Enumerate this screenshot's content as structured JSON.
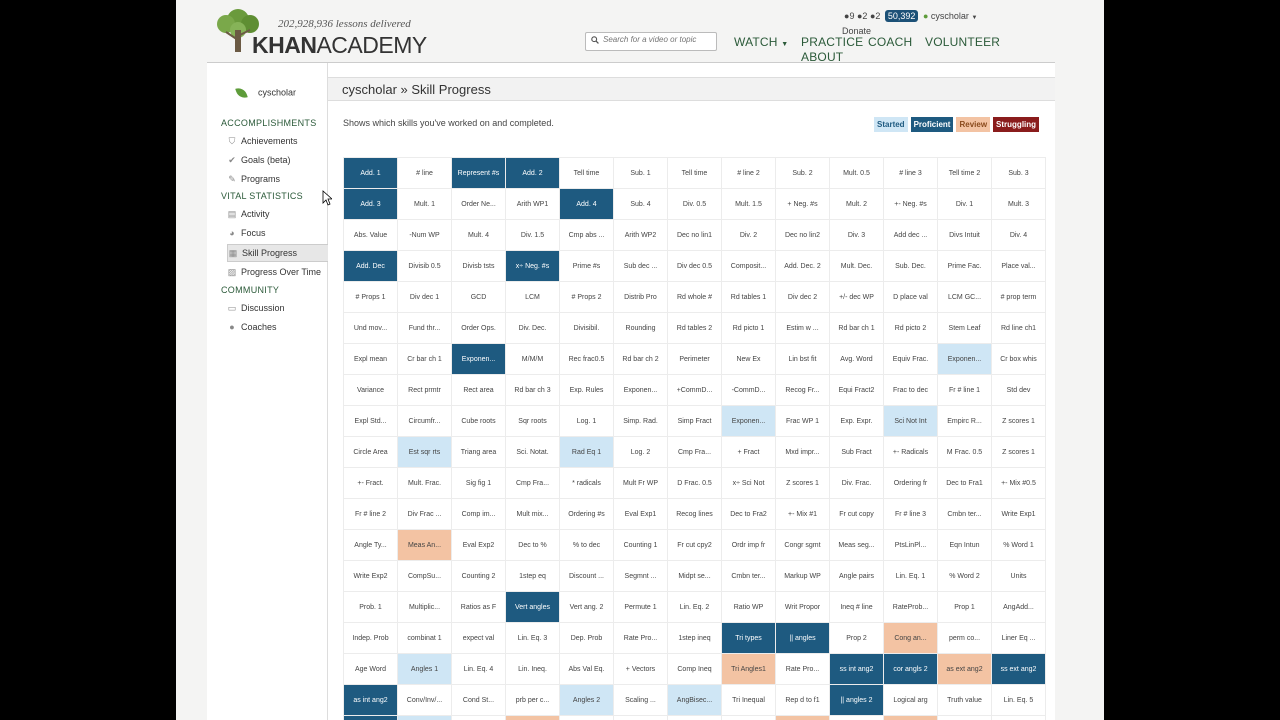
{
  "header": {
    "lessons_delivered": "202,928,936 lessons delivered",
    "brand_bold": "KHAN",
    "brand_light": "ACADEMY",
    "search_placeholder": "Search for a video or topic",
    "nav": {
      "watch": "WATCH",
      "practice": "PRACTICE",
      "coach": "COACH",
      "volunteer": "VOLUNTEER",
      "about": "ABOUT"
    },
    "user": {
      "badges": "9",
      "badges2": "2",
      "badges3": "2",
      "points": "50,392",
      "name": "cyscholar",
      "donate": "Donate"
    }
  },
  "sidebar": {
    "user": "cyscholar",
    "sections": {
      "accomplishments": "ACCOMPLISHMENTS",
      "vital": "VITAL STATISTICS",
      "community": "COMMUNITY"
    },
    "items": {
      "achievements": "Achievements",
      "goals": "Goals (beta)",
      "programs": "Programs",
      "activity": "Activity",
      "focus": "Focus",
      "skill_progress": "Skill Progress",
      "progress_over_time": "Progress Over Time",
      "discussion": "Discussion",
      "coaches": "Coaches"
    }
  },
  "main": {
    "title": "cyscholar » Skill Progress",
    "description": "Shows which skills you've worked on and completed.",
    "legend": [
      {
        "label": "Started",
        "bg": "#cfe6f5",
        "fg": "#1e5a80"
      },
      {
        "label": "Proficient",
        "bg": "#1e5a80",
        "fg": "#ffffff"
      },
      {
        "label": "Review",
        "bg": "#f3c3a3",
        "fg": "#8a4a1c"
      },
      {
        "label": "Struggling",
        "bg": "#8a1c1c",
        "fg": "#ffffff"
      }
    ],
    "grid": [
      [
        [
          "Add. 1",
          "p"
        ],
        [
          "# line",
          ""
        ],
        [
          "Represent #s",
          "p"
        ],
        [
          "Add. 2",
          "p"
        ],
        [
          "Tell time",
          ""
        ],
        [
          "Sub. 1",
          ""
        ],
        [
          "Tell time",
          ""
        ],
        [
          "# line 2",
          ""
        ],
        [
          "Sub. 2",
          ""
        ],
        [
          "Mult. 0.5",
          ""
        ],
        [
          "# line 3",
          ""
        ],
        [
          "Tell time 2",
          ""
        ],
        [
          "Sub. 3",
          ""
        ]
      ],
      [
        [
          "Add. 3",
          "p"
        ],
        [
          "Mult. 1",
          ""
        ],
        [
          "Order Ne...",
          ""
        ],
        [
          "Arith WP1",
          ""
        ],
        [
          "Add. 4",
          "p"
        ],
        [
          "Sub. 4",
          ""
        ],
        [
          "Div. 0.5",
          ""
        ],
        [
          "Mult. 1.5",
          ""
        ],
        [
          "+ Neg. #s",
          ""
        ],
        [
          "Mult. 2",
          ""
        ],
        [
          "+- Neg. #s",
          ""
        ],
        [
          "Div. 1",
          ""
        ],
        [
          "Mult. 3",
          ""
        ]
      ],
      [
        [
          "Abs. Value",
          ""
        ],
        [
          "-Num WP",
          ""
        ],
        [
          "Mult. 4",
          ""
        ],
        [
          "Div. 1.5",
          ""
        ],
        [
          "Cmp abs ...",
          ""
        ],
        [
          "Arith WP2",
          ""
        ],
        [
          "Dec no lin1",
          ""
        ],
        [
          "Div. 2",
          ""
        ],
        [
          "Dec no lin2",
          ""
        ],
        [
          "Div. 3",
          ""
        ],
        [
          "Add dec ...",
          ""
        ],
        [
          "Divs Intuit",
          ""
        ],
        [
          "Div. 4",
          ""
        ]
      ],
      [
        [
          "Add. Dec",
          "p"
        ],
        [
          "Divisib 0.5",
          ""
        ],
        [
          "Divisb tsts",
          ""
        ],
        [
          "x÷ Neg. #s",
          "p"
        ],
        [
          "Prime #s",
          ""
        ],
        [
          "Sub dec ...",
          ""
        ],
        [
          "Div dec 0.5",
          ""
        ],
        [
          "Composit...",
          ""
        ],
        [
          "Add. Dec. 2",
          ""
        ],
        [
          "Mult. Dec.",
          ""
        ],
        [
          "Sub. Dec.",
          ""
        ],
        [
          "Prime Fac.",
          ""
        ],
        [
          "Place val...",
          ""
        ]
      ],
      [
        [
          "# Props 1",
          ""
        ],
        [
          "Div dec 1",
          ""
        ],
        [
          "GCD",
          ""
        ],
        [
          "LCM",
          ""
        ],
        [
          "# Props 2",
          ""
        ],
        [
          "Distrib Pro",
          ""
        ],
        [
          "Rd whole #",
          ""
        ],
        [
          "Rd tables 1",
          ""
        ],
        [
          "Div dec 2",
          ""
        ],
        [
          "+/- dec WP",
          ""
        ],
        [
          "D place val",
          ""
        ],
        [
          "LCM GC...",
          ""
        ],
        [
          "# prop term",
          ""
        ]
      ],
      [
        [
          "Und mov...",
          ""
        ],
        [
          "Fund thr...",
          ""
        ],
        [
          "Order Ops.",
          ""
        ],
        [
          "Div. Dec.",
          ""
        ],
        [
          "Divisibil.",
          ""
        ],
        [
          "Rounding",
          ""
        ],
        [
          "Rd tables 2",
          ""
        ],
        [
          "Rd picto 1",
          ""
        ],
        [
          "Estim w ...",
          ""
        ],
        [
          "Rd bar ch 1",
          ""
        ],
        [
          "Rd picto 2",
          ""
        ],
        [
          "Stem Leaf",
          ""
        ],
        [
          "Rd line ch1",
          ""
        ]
      ],
      [
        [
          "Expl mean",
          ""
        ],
        [
          "Cr bar ch 1",
          ""
        ],
        [
          "Exponen...",
          "p"
        ],
        [
          "M/M/M",
          ""
        ],
        [
          "Rec frac0.5",
          ""
        ],
        [
          "Rd bar ch 2",
          ""
        ],
        [
          "Perimeter",
          ""
        ],
        [
          "New Ex",
          ""
        ],
        [
          "Lin bst fit",
          ""
        ],
        [
          "Avg. Word",
          ""
        ],
        [
          "Equiv Frac.",
          ""
        ],
        [
          "Exponen...",
          "s"
        ],
        [
          "Cr box whis",
          ""
        ]
      ],
      [
        [
          "Variance",
          ""
        ],
        [
          "Rect prmtr",
          ""
        ],
        [
          "Rect area",
          ""
        ],
        [
          "Rd bar ch 3",
          ""
        ],
        [
          "Exp. Rules",
          ""
        ],
        [
          "Exponen...",
          ""
        ],
        [
          "+CommD...",
          ""
        ],
        [
          "-CommD...",
          ""
        ],
        [
          "Recog Fr...",
          ""
        ],
        [
          "Equi Fract2",
          ""
        ],
        [
          "Frac to dec",
          ""
        ],
        [
          "Fr # line 1",
          ""
        ],
        [
          "Std dev",
          ""
        ]
      ],
      [
        [
          "Expl Std...",
          ""
        ],
        [
          "Circumfr...",
          ""
        ],
        [
          "Cube roots",
          ""
        ],
        [
          "Sqr roots",
          ""
        ],
        [
          "Log. 1",
          ""
        ],
        [
          "Simp. Rad.",
          ""
        ],
        [
          "Simp Fract",
          ""
        ],
        [
          "Exponen...",
          "s"
        ],
        [
          "Frac WP 1",
          ""
        ],
        [
          "Exp. Expr.",
          ""
        ],
        [
          "Sci Not Int",
          "s"
        ],
        [
          "Empirc R...",
          ""
        ],
        [
          "Z scores 1",
          ""
        ]
      ],
      [
        [
          "Circle Area",
          ""
        ],
        [
          "Est sqr rts",
          "s"
        ],
        [
          "Triang area",
          ""
        ],
        [
          "Sci. Notat.",
          ""
        ],
        [
          "Rad Eq 1",
          "s"
        ],
        [
          "Log. 2",
          ""
        ],
        [
          "Cmp Fra...",
          ""
        ],
        [
          "+ Fract",
          ""
        ],
        [
          "Mxd impr...",
          ""
        ],
        [
          "Sub Fract",
          ""
        ],
        [
          "+- Radicals",
          ""
        ],
        [
          "M Frac. 0.5",
          ""
        ],
        [
          "Z scores 1",
          ""
        ]
      ],
      [
        [
          "+- Fract.",
          ""
        ],
        [
          "Mult. Frac.",
          ""
        ],
        [
          "Sig fig 1",
          ""
        ],
        [
          "Cmp Fra...",
          ""
        ],
        [
          "* radicals",
          ""
        ],
        [
          "Mult Fr WP",
          ""
        ],
        [
          "D Frac. 0.5",
          ""
        ],
        [
          "x÷ Sci Not",
          ""
        ],
        [
          "Z scores 1",
          ""
        ],
        [
          "Div. Frac.",
          ""
        ],
        [
          "Ordering fr",
          ""
        ],
        [
          "Dec to Fra1",
          ""
        ],
        [
          "+- Mix #0.5",
          ""
        ]
      ],
      [
        [
          "Fr # line 2",
          ""
        ],
        [
          "Div Frac ...",
          ""
        ],
        [
          "Comp im...",
          ""
        ],
        [
          "Mult mix...",
          ""
        ],
        [
          "Ordering #s",
          ""
        ],
        [
          "Eval Exp1",
          ""
        ],
        [
          "Recog lines",
          ""
        ],
        [
          "Dec to Fra2",
          ""
        ],
        [
          "+- Mix #1",
          ""
        ],
        [
          "Fr cut copy",
          ""
        ],
        [
          "Fr # line 3",
          ""
        ],
        [
          "Cmbn ter...",
          ""
        ],
        [
          "Write Exp1",
          ""
        ]
      ],
      [
        [
          "Angle Ty...",
          ""
        ],
        [
          "Meas An...",
          "r"
        ],
        [
          "Eval Exp2",
          ""
        ],
        [
          "Dec to %",
          ""
        ],
        [
          "% to dec",
          ""
        ],
        [
          "Counting 1",
          ""
        ],
        [
          "Fr cut cpy2",
          ""
        ],
        [
          "Ordr imp fr",
          ""
        ],
        [
          "Congr sgmt",
          ""
        ],
        [
          "Meas seg...",
          ""
        ],
        [
          "PtsLinPl...",
          ""
        ],
        [
          "Eqn Intun",
          ""
        ],
        [
          "% Word 1",
          ""
        ]
      ],
      [
        [
          "Write Exp2",
          ""
        ],
        [
          "CompSu...",
          ""
        ],
        [
          "Counting 2",
          ""
        ],
        [
          "1step eq",
          ""
        ],
        [
          "Discount ...",
          ""
        ],
        [
          "Segmnt ...",
          ""
        ],
        [
          "Midpt se...",
          ""
        ],
        [
          "Cmbn ter...",
          ""
        ],
        [
          "Markup WP",
          ""
        ],
        [
          "Angle pairs",
          ""
        ],
        [
          "Lin. Eq. 1",
          ""
        ],
        [
          "% Word 2",
          ""
        ],
        [
          "Units",
          ""
        ]
      ],
      [
        [
          "Prob. 1",
          ""
        ],
        [
          "Multiplic...",
          ""
        ],
        [
          "Ratios as F",
          ""
        ],
        [
          "Vert angles",
          "p"
        ],
        [
          "Vert ang. 2",
          ""
        ],
        [
          "Permute 1",
          ""
        ],
        [
          "Lin. Eq. 2",
          ""
        ],
        [
          "Ratio WP",
          ""
        ],
        [
          "Writ Propor",
          ""
        ],
        [
          "Ineq # line",
          ""
        ],
        [
          "RateProb...",
          ""
        ],
        [
          "Prop 1",
          ""
        ],
        [
          "AngAdd...",
          ""
        ]
      ],
      [
        [
          "Indep. Prob",
          ""
        ],
        [
          "combinat 1",
          ""
        ],
        [
          "expect val",
          ""
        ],
        [
          "Lin. Eq. 3",
          ""
        ],
        [
          "Dep. Prob",
          ""
        ],
        [
          "Rate Pro...",
          ""
        ],
        [
          "1step ineq",
          ""
        ],
        [
          "Tri types",
          "p"
        ],
        [
          "|| angles",
          "p"
        ],
        [
          "Prop 2",
          ""
        ],
        [
          "Cong an...",
          "r"
        ],
        [
          "perm co...",
          ""
        ],
        [
          "Liner Eq ...",
          ""
        ]
      ],
      [
        [
          "Age Word",
          ""
        ],
        [
          "Angles 1",
          "s"
        ],
        [
          "Lin. Eq. 4",
          ""
        ],
        [
          "Lin. Ineq.",
          ""
        ],
        [
          "Abs Val Eq.",
          ""
        ],
        [
          "+ Vectors",
          ""
        ],
        [
          "Comp Ineq",
          ""
        ],
        [
          "Tri Angles1",
          "r"
        ],
        [
          "Rate Pro...",
          ""
        ],
        [
          "ss int ang2",
          "p"
        ],
        [
          "cor angls 2",
          "p"
        ],
        [
          "as ext ang2",
          "r"
        ],
        [
          "ss ext ang2",
          "p"
        ]
      ],
      [
        [
          "as int ang2",
          "p"
        ],
        [
          "Conv/Inv/...",
          ""
        ],
        [
          "Cond St...",
          ""
        ],
        [
          "prb per c...",
          ""
        ],
        [
          "Angles 2",
          "s"
        ],
        [
          "Scaling ...",
          ""
        ],
        [
          "AngBisec...",
          "s"
        ],
        [
          "Tri Inequal",
          ""
        ],
        [
          "Rep d to f1",
          ""
        ],
        [
          "|| angles 2",
          "p"
        ],
        [
          "Logical arg",
          ""
        ],
        [
          "Truth value",
          ""
        ],
        [
          "Lin. Eq. 5",
          ""
        ]
      ],
      [
        [
          "",
          "p"
        ],
        [
          "",
          "s"
        ],
        [
          "",
          ""
        ],
        [
          "",
          "r"
        ],
        [
          "",
          ""
        ],
        [
          "",
          ""
        ],
        [
          "",
          ""
        ],
        [
          "",
          ""
        ],
        [
          "",
          "r"
        ],
        [
          "",
          ""
        ],
        [
          "",
          "r"
        ],
        [
          "",
          ""
        ],
        [
          "",
          ""
        ]
      ]
    ]
  }
}
